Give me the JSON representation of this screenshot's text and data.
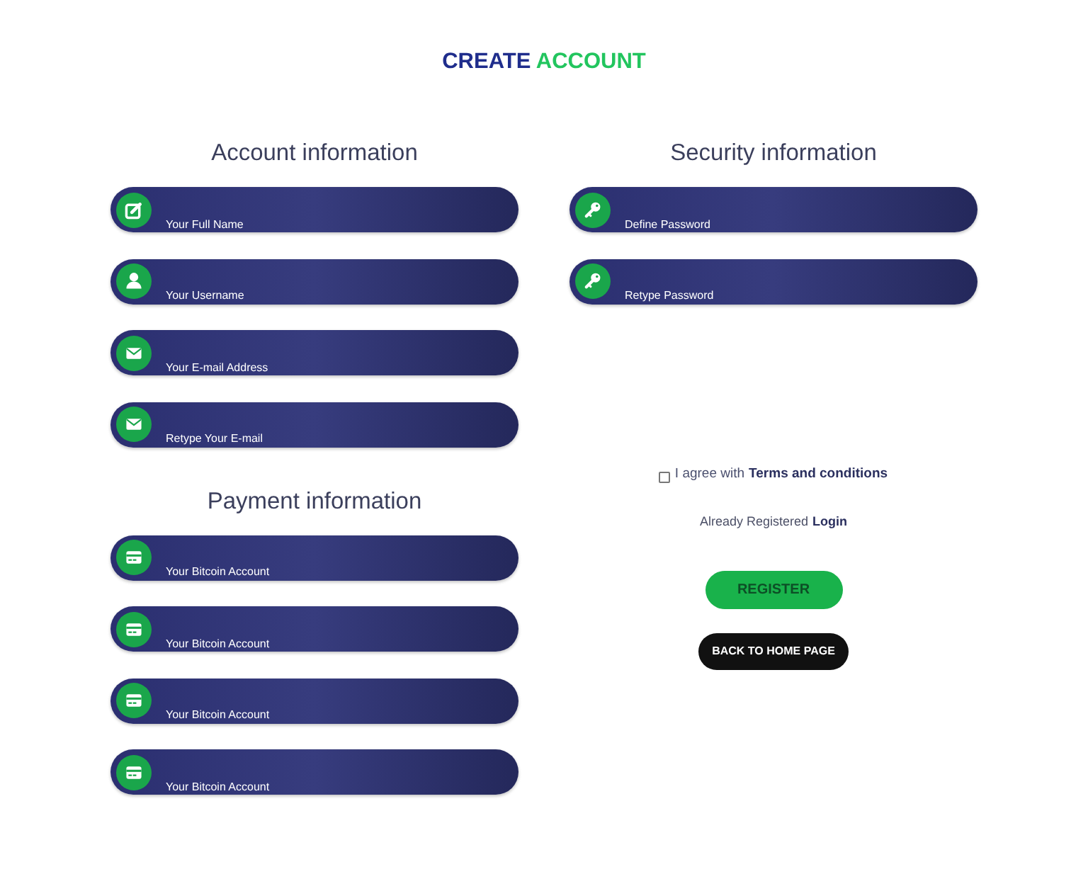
{
  "title": [
    {
      "text": "CREATE",
      "color": "#1f2d8c"
    },
    {
      "text": "ACCOUNT",
      "color": "#22c55e"
    }
  ],
  "account_information": {
    "heading": "Account information",
    "fields": [
      {
        "kind": "name",
        "placeholder": "Your Full Name"
      },
      {
        "kind": "username",
        "placeholder": "Your Username"
      },
      {
        "kind": "email",
        "placeholder": "Your E-mail Address"
      },
      {
        "kind": "email",
        "placeholder": "Retype Your E-mail"
      }
    ]
  },
  "payment_information": {
    "heading": "Payment information",
    "fields": [
      {
        "kind": "payment",
        "placeholder": "Your Bitcoin Account"
      },
      {
        "kind": "payment",
        "placeholder": "Your Bitcoin Account"
      },
      {
        "kind": "payment",
        "placeholder": "Your Bitcoin Account"
      },
      {
        "kind": "payment",
        "placeholder": "Your Bitcoin Account"
      }
    ]
  },
  "security_information": {
    "heading": "Security information",
    "fields": [
      {
        "kind": "password",
        "placeholder": "Define Password"
      },
      {
        "kind": "password",
        "placeholder": "Retype Password"
      }
    ]
  },
  "agreement": {
    "checked": false,
    "label": "I agree with",
    "link": "Terms and conditions"
  },
  "login_prompt": {
    "text": "Already Registered",
    "link": "Login"
  },
  "buttons": [
    {
      "label": "REGISTER",
      "kind": "primary"
    },
    {
      "label": "BACK TO HOME PAGE",
      "kind": "dark"
    }
  ]
}
